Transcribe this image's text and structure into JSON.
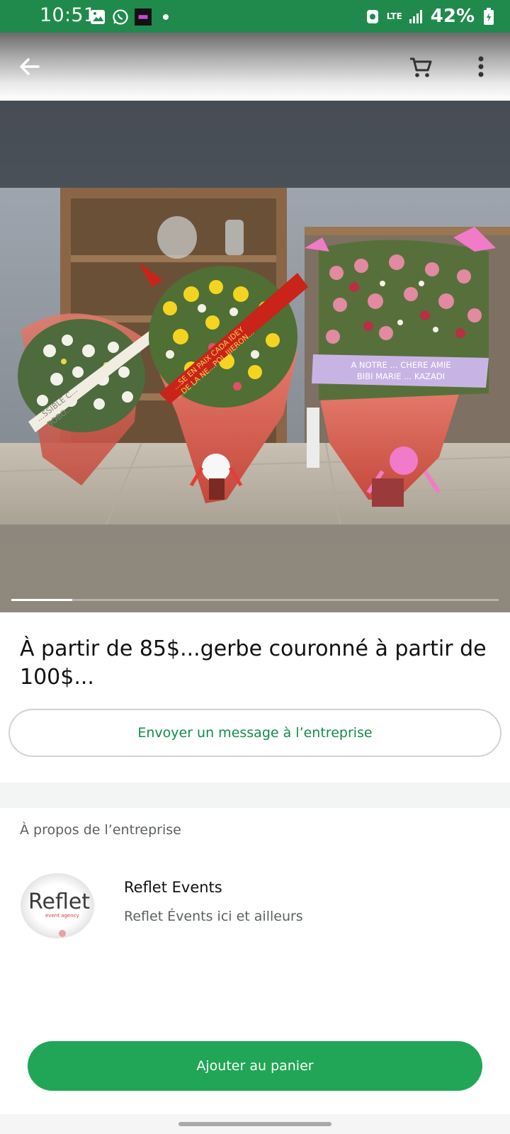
{
  "status_bar": {
    "time": "10:51",
    "network": "LTE",
    "battery": "42%",
    "bar_color": "#1f8a4c",
    "icons": [
      "gallery-icon",
      "whatsapp-icon",
      "app-icon",
      "dot-icon",
      "data-saver-icon",
      "lte-icon",
      "signal-icon",
      "battery-icon"
    ]
  },
  "app_bar": {
    "icons": [
      "arrow-back-icon",
      "cart-icon",
      "more-vert-icon"
    ]
  },
  "gallery": {
    "image_index": 1,
    "image_count": 8,
    "ribbons": {
      "left": [
        "...SSIBLE C...",
        "BOBO..."
      ],
      "middle": [
        "...SE EN PAIX CADA IDEY",
        "...DE LA NE...POL IJIERON..."
      ],
      "right": [
        "A NOTRE ... CHERE AMIE",
        "BIBI MARIE ... KAZADI"
      ]
    }
  },
  "product": {
    "title": "À partir de 85$...gerbe couronné à partir de 100$..."
  },
  "actions": {
    "message_label": "Envoyer un message à l’entreprise",
    "add_to_cart_label": "Ajouter au panier"
  },
  "about": {
    "heading": "À propos de l’entreprise",
    "business_name": "Reflet Events",
    "business_description": "Reflet Évents ici et ailleurs",
    "logo_text": "Reflet",
    "logo_subtext": "event agency"
  },
  "colors": {
    "accent": "#20a656",
    "accent_text": "#128c4a"
  }
}
